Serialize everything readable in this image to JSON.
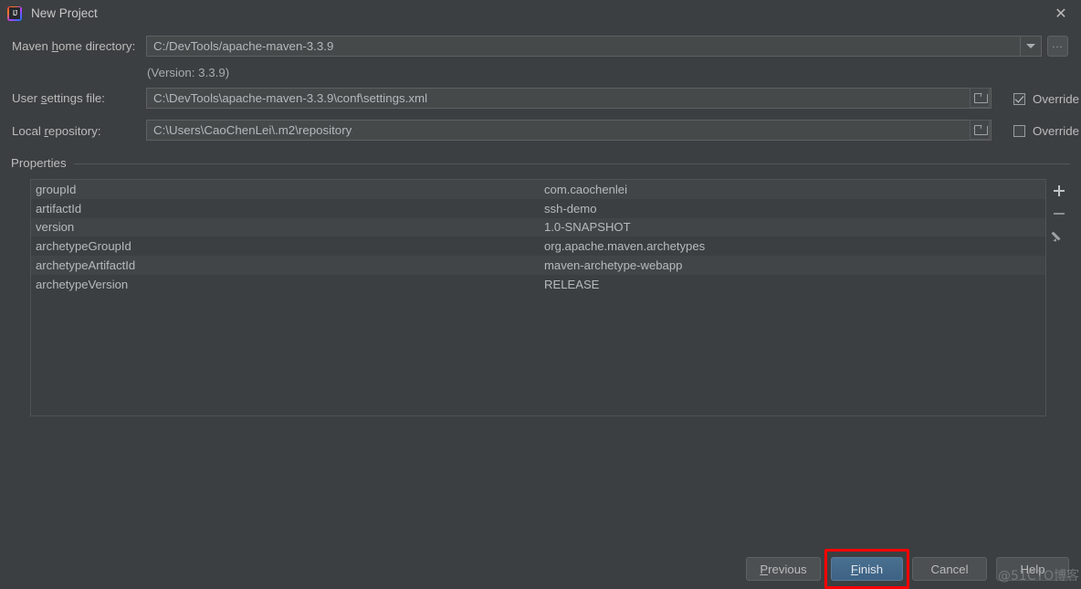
{
  "window": {
    "title": "New Project",
    "app_icon": "intellij-idea-logo",
    "close_icon": "close-icon"
  },
  "form": {
    "maven_home": {
      "label_prefix": "Maven ",
      "label_mnemonic": "h",
      "label_suffix": "ome directory:",
      "value": "C:/DevTools/apache-maven-3.3.9",
      "dropdown_icon": "chevron-down-icon",
      "browse_label": "...",
      "version_note": "(Version: 3.3.9)"
    },
    "user_settings": {
      "label_prefix": "User ",
      "label_mnemonic": "s",
      "label_suffix": "ettings file:",
      "value": "C:\\DevTools\\apache-maven-3.3.9\\conf\\settings.xml",
      "browse_icon": "folder-icon",
      "override_label": "Override",
      "override_checked": true
    },
    "local_repository": {
      "label_prefix": "Local ",
      "label_mnemonic": "r",
      "label_suffix": "epository:",
      "value": "C:\\Users\\CaoChenLei\\.m2\\repository",
      "browse_icon": "folder-icon",
      "override_label": "Override",
      "override_checked": false
    }
  },
  "properties": {
    "group_label": "Properties",
    "rows": [
      {
        "key": "groupId",
        "value": "com.caochenlei"
      },
      {
        "key": "artifactId",
        "value": "ssh-demo"
      },
      {
        "key": "version",
        "value": "1.0-SNAPSHOT"
      },
      {
        "key": "archetypeGroupId",
        "value": "org.apache.maven.archetypes"
      },
      {
        "key": "archetypeArtifactId",
        "value": "maven-archetype-webapp"
      },
      {
        "key": "archetypeVersion",
        "value": "RELEASE"
      }
    ],
    "toolbar": {
      "add_icon": "plus-icon",
      "remove_icon": "minus-icon",
      "edit_icon": "pencil-icon"
    }
  },
  "footer": {
    "previous": {
      "prefix": "",
      "mnemonic": "P",
      "suffix": "revious"
    },
    "finish": {
      "prefix": "",
      "mnemonic": "F",
      "suffix": "inish"
    },
    "cancel": {
      "label": "Cancel"
    },
    "help": {
      "label": "Help"
    },
    "highlight_color": "#ff0000",
    "default_button_color": "#44688a"
  },
  "watermark": {
    "text": "@51CTO博客"
  }
}
